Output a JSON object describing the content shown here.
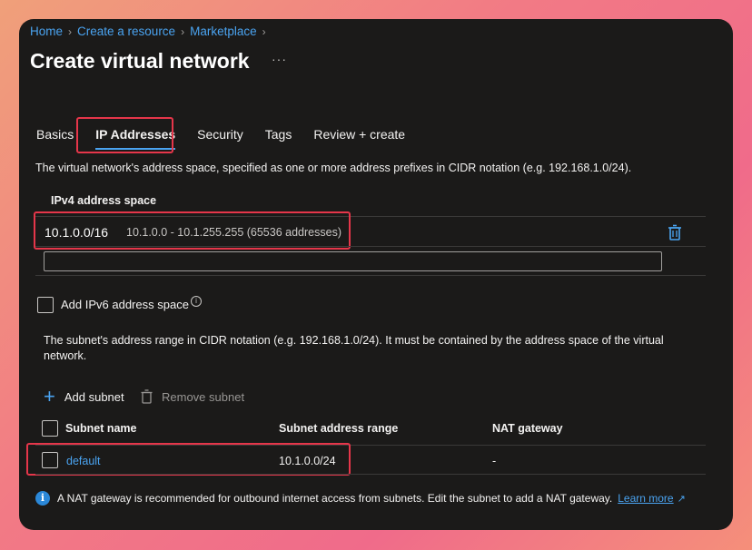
{
  "breadcrumb": {
    "items": [
      "Home",
      "Create a resource",
      "Marketplace"
    ]
  },
  "header": {
    "title": "Create virtual network",
    "more": "···"
  },
  "tabs": [
    "Basics",
    "IP Addresses",
    "Security",
    "Tags",
    "Review + create"
  ],
  "active_tab": "IP Addresses",
  "ip": {
    "description": "The virtual network's address space, specified as one or more address prefixes in CIDR notation (e.g. 192.168.1.0/24).",
    "ipv4_label": "IPv4 address space",
    "address": "10.1.0.0/16",
    "range": "10.1.0.0 - 10.1.255.255 (65536 addresses)",
    "new_address_value": "",
    "ipv6_label": "Add IPv6 address space"
  },
  "subnets": {
    "description": "The subnet's address range in CIDR notation (e.g. 192.168.1.0/24). It must be contained by the address space of the virtual network.",
    "add_label": "Add subnet",
    "remove_label": "Remove subnet",
    "columns": [
      "Subnet name",
      "Subnet address range",
      "NAT gateway"
    ],
    "rows": [
      {
        "name": "default",
        "range": "10.1.0.0/24",
        "nat": "-"
      }
    ]
  },
  "info": {
    "text": "A NAT gateway is recommended for outbound internet access from subnets. Edit the subnet to add a NAT gateway.",
    "link": "Learn more"
  },
  "colors": {
    "accent": "#4aa3f0",
    "highlight": "#e5364a",
    "background": "#1b1a19"
  }
}
